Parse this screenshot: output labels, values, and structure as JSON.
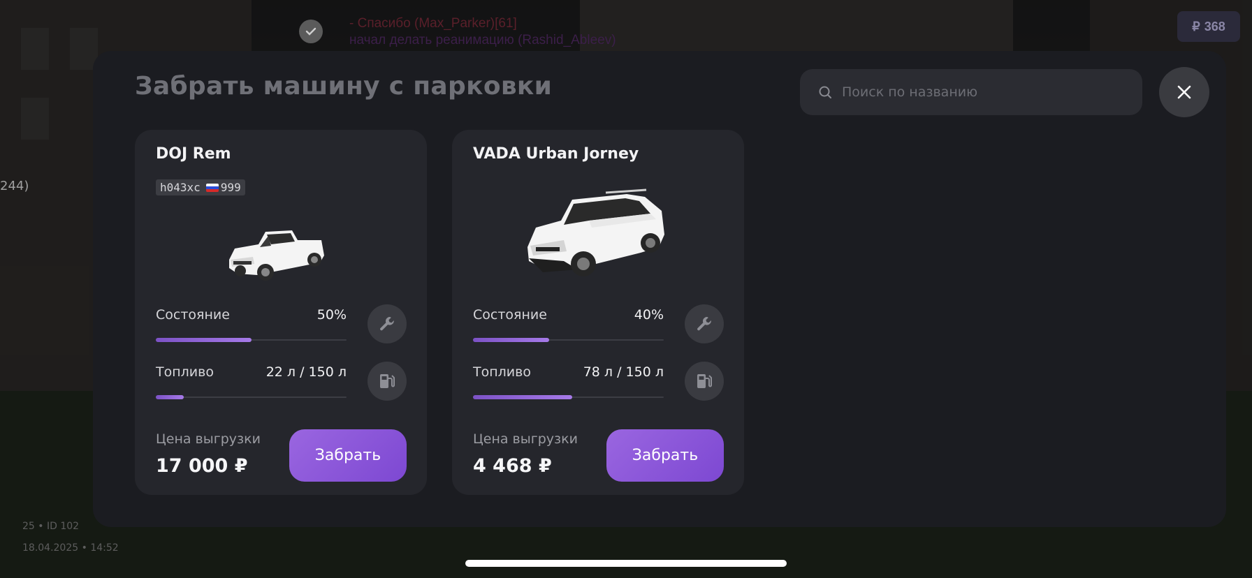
{
  "background": {
    "chat": [
      "- Спасибо (Max_Parker)[61]",
      "начал делать реанимацию (Rashid_Ableev)"
    ],
    "money_badge": "368",
    "money_symbol": "₽",
    "side_text": "244)",
    "footer_line1": "25 • ID 102",
    "footer_line2": "18.04.2025 • 14:52"
  },
  "modal": {
    "title": "Забрать машину с парковки",
    "search_placeholder": "Поиск по названию",
    "cars": [
      {
        "name": "DOJ Rem",
        "plate": "h043xc",
        "region": "999",
        "condition_label": "Состояние",
        "condition_value": "50%",
        "condition_fraction": 0.5,
        "fuel_label": "Топливо",
        "fuel_value": "22 л / 150 л",
        "fuel_fraction": 0.1467,
        "price_label": "Цена выгрузки",
        "price": "17 000 ₽",
        "button_label": "Забрать"
      },
      {
        "name": "VADA Urban Jorney",
        "condition_label": "Состояние",
        "condition_value": "40%",
        "condition_fraction": 0.4,
        "fuel_label": "Топливо",
        "fuel_value": "78 л / 150 л",
        "fuel_fraction": 0.52,
        "price_label": "Цена выгрузки",
        "price": "4 468 ₽",
        "button_label": "Забрать"
      }
    ]
  },
  "colors": {
    "accent": "#8a56d8",
    "panel": "#1b1c21",
    "card": "#25262c"
  },
  "icons": [
    "search-icon",
    "close-icon",
    "wrench-icon",
    "fuel-pump-icon",
    "check-icon",
    "ruble-icon"
  ]
}
